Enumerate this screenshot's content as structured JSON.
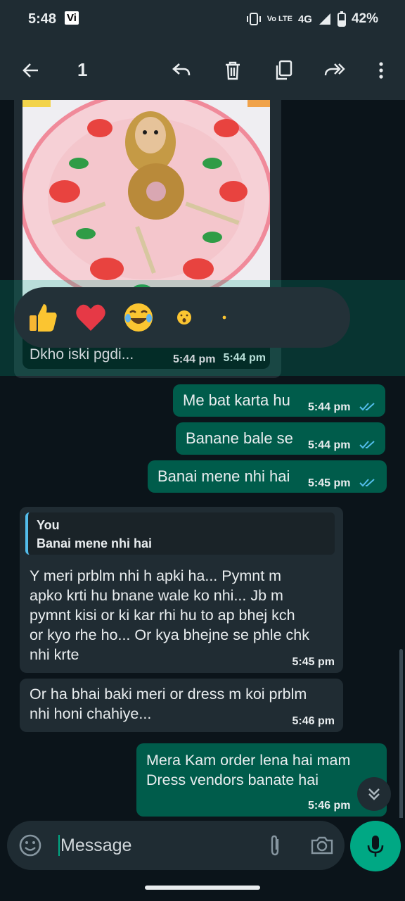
{
  "status_bar": {
    "time": "5:48",
    "carrier_badge": "Vi",
    "volte": "Vo LTE",
    "network": "4G",
    "battery": "42%"
  },
  "app_bar": {
    "selected_count": "1",
    "icons": [
      "back-arrow-icon",
      "reply-icon",
      "delete-icon",
      "copy-icon",
      "forward-icon",
      "more-vert-icon"
    ]
  },
  "chat": {
    "image_message": {
      "time": "5:44 pm"
    },
    "reaction_picker": {
      "emojis": [
        "👍",
        "❤️",
        "😂",
        "😮",
        "•"
      ]
    },
    "selected_message": {
      "text": "Dkho iski pgdi...",
      "time": "5:44 pm"
    },
    "outgoing_1": {
      "text": "Me bat karta hu",
      "time": "5:44 pm"
    },
    "outgoing_2": {
      "text": "Banane bale se",
      "time": "5:44 pm"
    },
    "outgoing_3": {
      "text": "Banai mene nhi hai",
      "time": "5:45 pm"
    },
    "incoming_reply": {
      "quote_author": "You",
      "quote_text": "Banai mene nhi hai",
      "lines": [
        "Y meri prblm nhi h apki ha... Pymnt m",
        "apko krti hu bnane wale ko nhi... Jb m",
        "pymnt kisi or ki kar rhi hu to ap bhej kch",
        "or kyo rhe ho... Or kya bhejne se phle chk",
        "nhi krte"
      ],
      "time": "5:45 pm"
    },
    "incoming_2": {
      "lines": [
        "Or ha bhai baki meri or dress m koi prblm",
        "nhi honi chahiye..."
      ],
      "time": "5:46 pm"
    },
    "outgoing_4": {
      "lines": [
        "Mera Kam order lena hai mam",
        "Dress vendors banate hai"
      ],
      "time": "5:46 pm"
    }
  },
  "composer": {
    "placeholder": "Message"
  },
  "colors": {
    "background": "#0b141a",
    "bar": "#1f2c33",
    "outgoing_bubble": "#005c4b",
    "incoming_bubble": "#202c33",
    "accent": "#00a884",
    "read_ticks": "#53bdeb"
  }
}
